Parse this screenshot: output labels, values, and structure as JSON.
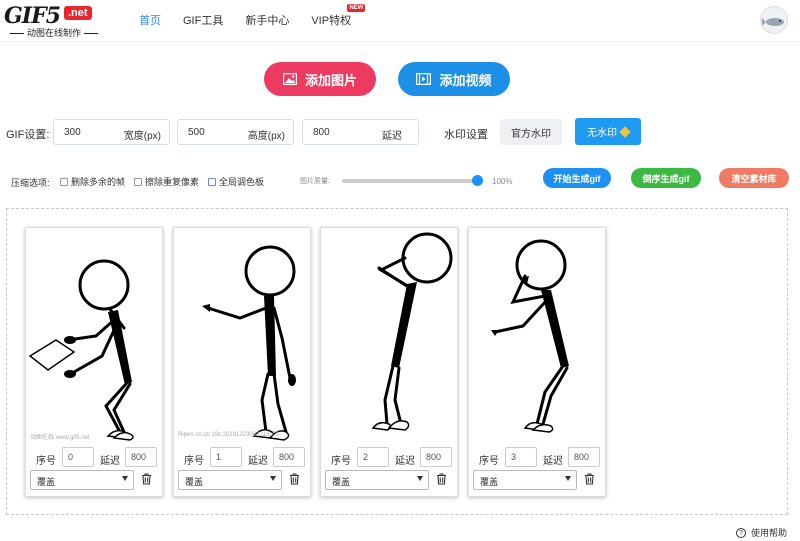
{
  "brand": {
    "logo": "GIF5",
    "logo_net": ".net",
    "tagline": "动图在线制作"
  },
  "nav": {
    "items": [
      {
        "label": "首页",
        "active": true
      },
      {
        "label": "GIF工具"
      },
      {
        "label": "新手中心"
      },
      {
        "label": "VIP特权",
        "badge": "NEW"
      }
    ]
  },
  "actions": {
    "add_image": "添加图片",
    "add_video": "添加视频"
  },
  "gif_settings": {
    "label": "GIF设置:",
    "width": {
      "value": "300",
      "unit": "宽度(px)"
    },
    "height": {
      "value": "500",
      "unit": "高度(px)"
    },
    "delay": {
      "value": "800",
      "unit": "延迟"
    }
  },
  "watermark": {
    "label": "水印设置",
    "official": "官方水印",
    "none": "无水印"
  },
  "compression": {
    "label": "压缩选项:",
    "options": [
      "删除多余的帧",
      "擦除重复像素",
      "全局调色板"
    ],
    "quality_label": "图片质量:",
    "quality_value": "100%",
    "quality_fraction": 1.0
  },
  "generate": {
    "start": "开始生成gif",
    "reverse": "倒序生成gif",
    "clear": "清空素材库"
  },
  "frames": [
    {
      "index_label": "序号",
      "index": "0",
      "delay_label": "延迟",
      "delay": "800",
      "mode": "覆盖",
      "watermark_text": "动图在线 www.gif5.net"
    },
    {
      "index_label": "序号",
      "index": "1",
      "delay_label": "延迟",
      "delay": "800",
      "mode": "覆盖",
      "watermark_text": "Ripen.cn.ch 19s.20191223083718c00"
    },
    {
      "index_label": "序号",
      "index": "2",
      "delay_label": "延迟",
      "delay": "800",
      "mode": "覆盖"
    },
    {
      "index_label": "序号",
      "index": "3",
      "delay_label": "延迟",
      "delay": "800",
      "mode": "覆盖"
    }
  ],
  "help": "使用帮助",
  "colors": {
    "primary": "#1c8fe6",
    "add_image": "#ec3a61",
    "green": "#3cb942",
    "orange": "#f07a63",
    "brand_red": "#e8262f"
  }
}
